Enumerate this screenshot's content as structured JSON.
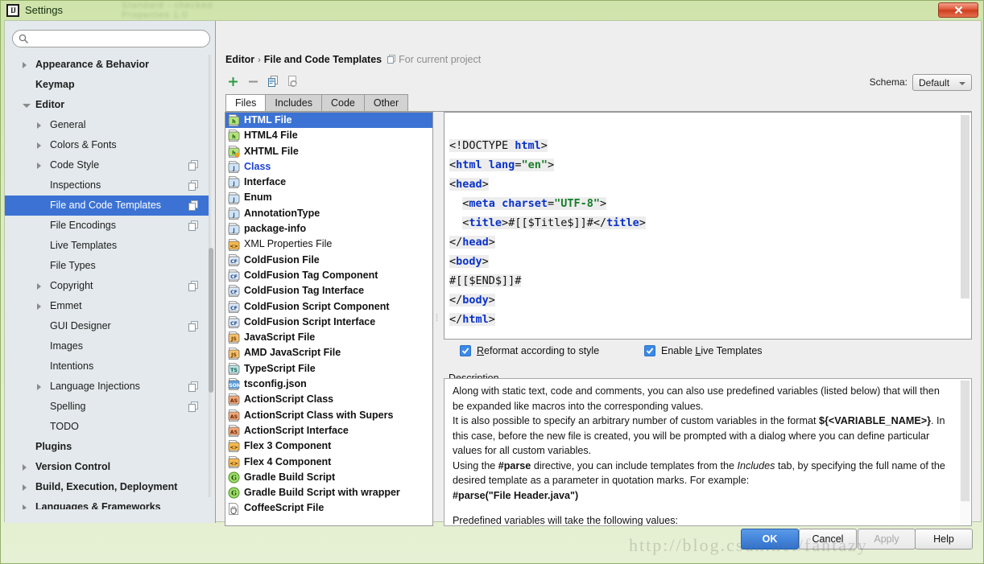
{
  "window": {
    "title": "Settings",
    "app_icon": "intellij-idea-logo",
    "close_label": "✕",
    "ghost_lines": [
      "Standard - checked",
      "Properties 1.0"
    ]
  },
  "sidebar": {
    "search": {
      "value": "",
      "placeholder": ""
    },
    "items": [
      {
        "label": "Appearance & Behavior",
        "level": 0,
        "arrow": "collapsed",
        "badge": false,
        "selected": false
      },
      {
        "label": "Keymap",
        "level": 0,
        "arrow": "none",
        "badge": false,
        "selected": false
      },
      {
        "label": "Editor",
        "level": 0,
        "arrow": "expanded",
        "badge": false,
        "selected": false
      },
      {
        "label": "General",
        "level": 1,
        "arrow": "collapsed",
        "badge": false,
        "selected": false
      },
      {
        "label": "Colors & Fonts",
        "level": 1,
        "arrow": "collapsed",
        "badge": false,
        "selected": false
      },
      {
        "label": "Code Style",
        "level": 1,
        "arrow": "collapsed",
        "badge": true,
        "selected": false
      },
      {
        "label": "Inspections",
        "level": 1,
        "arrow": "none",
        "badge": true,
        "selected": false
      },
      {
        "label": "File and Code Templates",
        "level": 1,
        "arrow": "none",
        "badge": true,
        "selected": true
      },
      {
        "label": "File Encodings",
        "level": 1,
        "arrow": "none",
        "badge": true,
        "selected": false
      },
      {
        "label": "Live Templates",
        "level": 1,
        "arrow": "none",
        "badge": false,
        "selected": false
      },
      {
        "label": "File Types",
        "level": 1,
        "arrow": "none",
        "badge": false,
        "selected": false
      },
      {
        "label": "Copyright",
        "level": 1,
        "arrow": "collapsed",
        "badge": true,
        "selected": false
      },
      {
        "label": "Emmet",
        "level": 1,
        "arrow": "collapsed",
        "badge": false,
        "selected": false
      },
      {
        "label": "GUI Designer",
        "level": 1,
        "arrow": "none",
        "badge": true,
        "selected": false
      },
      {
        "label": "Images",
        "level": 1,
        "arrow": "none",
        "badge": false,
        "selected": false
      },
      {
        "label": "Intentions",
        "level": 1,
        "arrow": "none",
        "badge": false,
        "selected": false
      },
      {
        "label": "Language Injections",
        "level": 1,
        "arrow": "collapsed",
        "badge": true,
        "selected": false
      },
      {
        "label": "Spelling",
        "level": 1,
        "arrow": "none",
        "badge": true,
        "selected": false
      },
      {
        "label": "TODO",
        "level": 1,
        "arrow": "none",
        "badge": false,
        "selected": false
      },
      {
        "label": "Plugins",
        "level": 0,
        "arrow": "none",
        "badge": false,
        "selected": false
      },
      {
        "label": "Version Control",
        "level": 0,
        "arrow": "collapsed",
        "badge": false,
        "selected": false
      },
      {
        "label": "Build, Execution, Deployment",
        "level": 0,
        "arrow": "collapsed",
        "badge": false,
        "selected": false
      },
      {
        "label": "Languages & Frameworks",
        "level": 0,
        "arrow": "collapsed",
        "badge": false,
        "selected": false
      }
    ]
  },
  "breadcrumb": {
    "parent": "Editor",
    "separator": "›",
    "current": "File and Code Templates",
    "scope_hint": "For current project",
    "scope_icon": "project-scope-icon"
  },
  "toolbar": {
    "buttons": [
      {
        "name": "add-template-button",
        "icon": "plus-icon",
        "enabled": true
      },
      {
        "name": "remove-template-button",
        "icon": "minus-icon",
        "enabled": false
      },
      {
        "name": "copy-template-button",
        "icon": "copy-icon",
        "enabled": true
      },
      {
        "name": "reset-template-button",
        "icon": "reset-icon",
        "enabled": false
      }
    ]
  },
  "schema": {
    "label": "Schema:",
    "value": "Default"
  },
  "tabs": [
    {
      "label": "Files",
      "active": true
    },
    {
      "label": "Includes",
      "active": false
    },
    {
      "label": "Code",
      "active": false
    },
    {
      "label": "Other",
      "active": false
    }
  ],
  "templates": [
    {
      "name": "HTML File",
      "icon": "html-file-icon",
      "style": "selected"
    },
    {
      "name": "HTML4 File",
      "icon": "html-file-icon",
      "style": "bold"
    },
    {
      "name": "XHTML File",
      "icon": "xhtml-file-icon",
      "style": "bold"
    },
    {
      "name": "Class",
      "icon": "java-file-icon",
      "style": "blue"
    },
    {
      "name": "Interface",
      "icon": "java-file-icon",
      "style": "bold"
    },
    {
      "name": "Enum",
      "icon": "java-file-icon",
      "style": "bold"
    },
    {
      "name": "AnnotationType",
      "icon": "java-file-icon",
      "style": "bold"
    },
    {
      "name": "package-info",
      "icon": "java-file-icon",
      "style": "bold"
    },
    {
      "name": "XML Properties File",
      "icon": "xml-file-icon",
      "style": "normal"
    },
    {
      "name": "ColdFusion File",
      "icon": "coldfusion-icon",
      "style": "bold"
    },
    {
      "name": "ColdFusion Tag Component",
      "icon": "coldfusion-icon",
      "style": "bold"
    },
    {
      "name": "ColdFusion Tag Interface",
      "icon": "coldfusion-icon",
      "style": "bold"
    },
    {
      "name": "ColdFusion Script Component",
      "icon": "coldfusion-icon",
      "style": "bold"
    },
    {
      "name": "ColdFusion Script Interface",
      "icon": "coldfusion-icon",
      "style": "bold"
    },
    {
      "name": "JavaScript File",
      "icon": "javascript-icon",
      "style": "bold"
    },
    {
      "name": "AMD JavaScript File",
      "icon": "javascript-icon",
      "style": "bold"
    },
    {
      "name": "TypeScript File",
      "icon": "typescript-icon",
      "style": "bold"
    },
    {
      "name": "tsconfig.json",
      "icon": "json-icon",
      "style": "bold"
    },
    {
      "name": "ActionScript Class",
      "icon": "actionscript-icon",
      "style": "bold"
    },
    {
      "name": "ActionScript Class with Supers",
      "icon": "actionscript-icon",
      "style": "bold"
    },
    {
      "name": "ActionScript Interface",
      "icon": "actionscript-icon",
      "style": "bold"
    },
    {
      "name": "Flex 3 Component",
      "icon": "flex-icon",
      "style": "bold"
    },
    {
      "name": "Flex 4 Component",
      "icon": "flex-icon",
      "style": "bold"
    },
    {
      "name": "Gradle Build Script",
      "icon": "gradle-icon",
      "style": "bold"
    },
    {
      "name": "Gradle Build Script with wrapper",
      "icon": "gradle-icon",
      "style": "bold"
    },
    {
      "name": "CoffeeScript File",
      "icon": "coffeescript-icon",
      "style": "bold"
    }
  ],
  "editor": {
    "language": "HTML",
    "lines": [
      "<!DOCTYPE html>",
      "<html lang=\"en\">",
      "<head>",
      "  <meta charset=\"UTF-8\">",
      "  <title>#[[$Title$]]#</title>",
      "</head>",
      "<body>",
      "#[[$END$]]#",
      "</body>",
      "</html>"
    ]
  },
  "options": {
    "reformat": {
      "label": "Reformat according to style",
      "checked": true,
      "mnemonic": "R"
    },
    "live_templates": {
      "label": "Enable Live Templates",
      "checked": true,
      "mnemonic": "L"
    }
  },
  "description": {
    "title": "Description",
    "paragraphs": [
      "Along with static text, code and comments, you can also use predefined variables (listed below) that will then be expanded like macros into the corresponding values.",
      "It is also possible to specify an arbitrary number of custom variables in the format ${<VARIABLE_NAME>}. In this case, before the new file is created, you will be prompted with a dialog where you can define particular values for all custom variables.",
      "Using the #parse directive, you can include templates from the Includes tab, by specifying the full name of the desired template as a parameter in quotation marks. For example:",
      "#parse(\"File Header.java\")",
      "Predefined variables will take the following values:"
    ],
    "bold_tokens": [
      "${<VARIABLE_NAME>}",
      "#parse",
      "#parse(\"File Header.java\")"
    ],
    "italic_tokens": [
      "Includes"
    ]
  },
  "footer": {
    "ok": "OK",
    "cancel": "Cancel",
    "apply": "Apply",
    "help": "Help",
    "apply_enabled": false
  },
  "watermark": "http://blog.csdn.net/fantazy",
  "colors": {
    "selection": "#3b72d4",
    "title_green": "#cfe3ab",
    "close_red": "#e0573a",
    "tag_blue": "#0a32c8",
    "value_green": "#157d28",
    "link_blue": "#1c42d4",
    "checkbox_blue": "#3b8ae8"
  }
}
